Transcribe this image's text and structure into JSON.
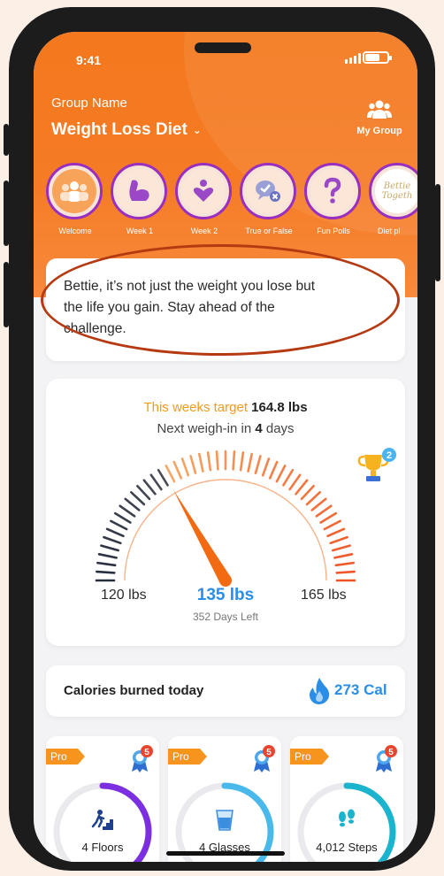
{
  "status": {
    "time": "9:41"
  },
  "header": {
    "group_label": "Group Name",
    "group_name": "Weight Loss Diet",
    "my_group_label": "My Group"
  },
  "stories": [
    {
      "label": "Welcome",
      "icon": "group-icon"
    },
    {
      "label": "Week 1",
      "icon": "muscle-arm-icon"
    },
    {
      "label": "Week 2",
      "icon": "heart-person-icon"
    },
    {
      "label": "True or False",
      "icon": "chat-check-icon"
    },
    {
      "label": "Fun Polls",
      "icon": "question-icon"
    },
    {
      "label": "Diet pl",
      "icon": "betties-together-logo",
      "thumb_text": "Bettie Togeth"
    }
  ],
  "quote": {
    "line1": "Bettie, it’s not just the weight you lose but",
    "line2": "the life you gain. Stay ahead of the",
    "line3": "challenge."
  },
  "target": {
    "label": "This weeks target",
    "value": "164.8 lbs",
    "next_prefix": "Next weigh-in in",
    "next_days": "4",
    "next_suffix": "days",
    "trophy_count": "2",
    "gauge_min": "120 lbs",
    "gauge_current": "135 lbs",
    "gauge_max": "165 lbs",
    "days_left": "352 Days Left",
    "gauge_min_value": 120,
    "gauge_max_value": 165,
    "gauge_current_value": 135
  },
  "calories": {
    "label": "Calories burned today",
    "value": "273 Cal"
  },
  "tiles": [
    {
      "badge": "Pro",
      "medal_count": "5",
      "value": "4 Floors",
      "icon": "stairs-climb-icon",
      "ring_color": "#7b2fe0",
      "progress": 0.62
    },
    {
      "badge": "Pro",
      "medal_count": "5",
      "value": "4 Glasses",
      "icon": "water-glass-icon",
      "ring_color": "#49b8ea",
      "progress": 0.55
    },
    {
      "badge": "Pro",
      "medal_count": "5",
      "value": "4,012 Steps",
      "icon": "footsteps-icon",
      "ring_color": "#1ab4cf",
      "progress": 0.58
    }
  ],
  "colors": {
    "accent": "#f4781d",
    "blue": "#2a8ee8",
    "story_ring": "#9a2fbf",
    "annotation": "#b53a12"
  }
}
